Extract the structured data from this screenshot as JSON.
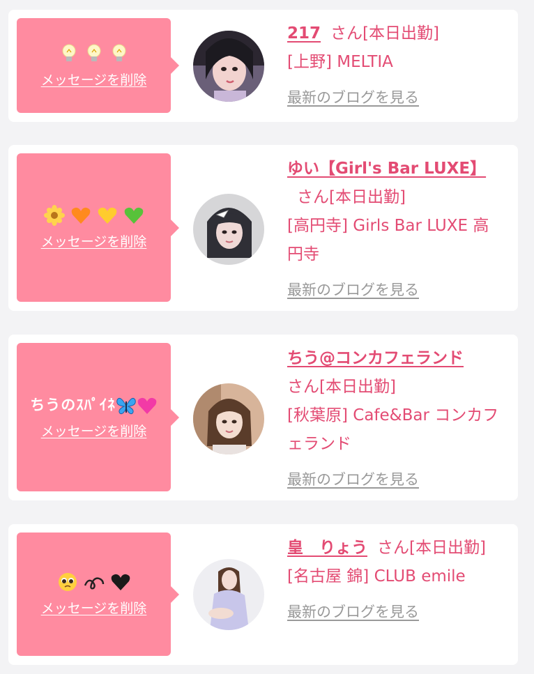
{
  "colors": {
    "background": "#f3f3f5",
    "card": "#ffffff",
    "bubble": "#ff8ba0",
    "accent_text": "#e34b73",
    "link_gray": "#999999"
  },
  "items": [
    {
      "message": "💡💡💡",
      "message_icons": [
        "lightbulb-icon",
        "lightbulb-icon",
        "lightbulb-icon"
      ],
      "delete_label": "メッセージを削除",
      "name": "217",
      "suffix": "さん[本日出勤]",
      "shop": "[上野] MELTIA",
      "blog_label": "最新のブログを見る"
    },
    {
      "message": "🌼🧡💛💚",
      "message_icons": [
        "flower-icon",
        "orange-heart-icon",
        "yellow-heart-icon",
        "green-heart-icon"
      ],
      "delete_label": "メッセージを削除",
      "name": "ゆい【Girl's Bar LUXE】",
      "suffix": "さん[本日出勤]",
      "shop": "[高円寺] Girls Bar LUXE 高円寺",
      "blog_label": "最新のブログを見る"
    },
    {
      "message": "ちうのｽﾊﾟｲﾈ🦋💗",
      "message_icons": [
        "butterfly-icon",
        "pink-heart-icon"
      ],
      "delete_label": "メッセージを削除",
      "name": "ちう@コンカフェランド",
      "suffix": "さん[本日出勤]",
      "shop": "[秋葉原] Cafe&Bar コンカフェランド",
      "blog_label": "最新のブログを見る"
    },
    {
      "message": "🥺➰🖤",
      "message_icons": [
        "pleading-face-icon",
        "curly-loop-icon",
        "black-heart-icon"
      ],
      "delete_label": "メッセージを削除",
      "name": "皇　りょう",
      "suffix": "さん[本日出勤]",
      "shop": "[名古屋 錦] CLUB emile",
      "blog_label": "最新のブログを見る"
    }
  ]
}
